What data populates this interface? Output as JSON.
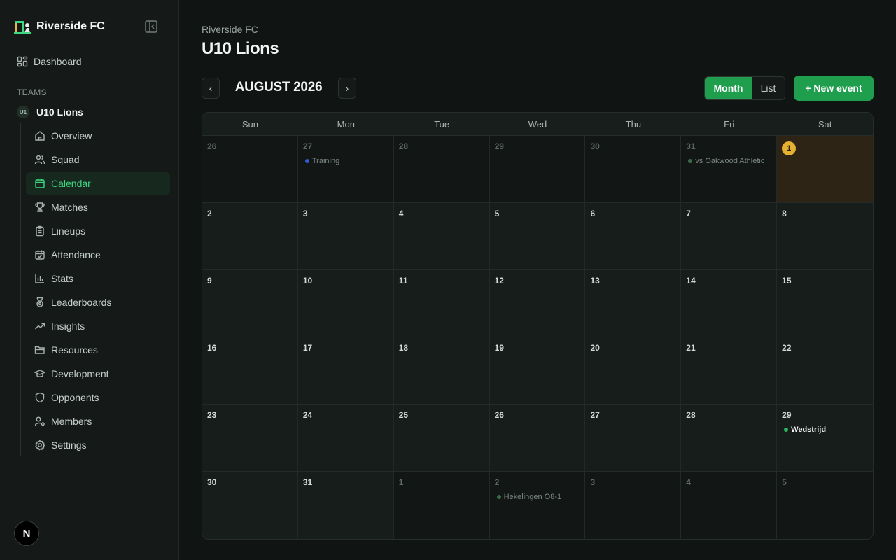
{
  "sidebar": {
    "brand": "Riverside FC",
    "dashboard": "Dashboard",
    "teams_label": "TEAMS",
    "team": {
      "badge": "U1",
      "name": "U10 Lions"
    },
    "items": [
      {
        "label": "Overview",
        "icon": "home-icon",
        "active": false
      },
      {
        "label": "Squad",
        "icon": "users-icon",
        "active": false
      },
      {
        "label": "Calendar",
        "icon": "calendar-icon",
        "active": true
      },
      {
        "label": "Matches",
        "icon": "trophy-icon",
        "active": false
      },
      {
        "label": "Lineups",
        "icon": "clipboard-icon",
        "active": false
      },
      {
        "label": "Attendance",
        "icon": "calendar-check-icon",
        "active": false
      },
      {
        "label": "Stats",
        "icon": "bar-chart-icon",
        "active": false
      },
      {
        "label": "Leaderboards",
        "icon": "medal-icon",
        "active": false
      },
      {
        "label": "Insights",
        "icon": "trending-up-icon",
        "active": false
      },
      {
        "label": "Resources",
        "icon": "folder-icon",
        "active": false
      },
      {
        "label": "Development",
        "icon": "graduation-cap-icon",
        "active": false
      },
      {
        "label": "Opponents",
        "icon": "shield-icon",
        "active": false
      },
      {
        "label": "Members",
        "icon": "user-cog-icon",
        "active": false
      },
      {
        "label": "Settings",
        "icon": "gear-icon",
        "active": false
      }
    ],
    "fab": "N"
  },
  "header": {
    "breadcrumb": "Riverside FC",
    "title": "U10 Lions"
  },
  "toolbar": {
    "prev": "‹",
    "next": "›",
    "month": "AUGUST 2026",
    "view_month": "Month",
    "view_list": "List",
    "new_event": "+ New event"
  },
  "calendar": {
    "weekdays": [
      "Sun",
      "Mon",
      "Tue",
      "Wed",
      "Thu",
      "Fri",
      "Sat"
    ],
    "weeks": [
      [
        {
          "day": "26",
          "outside": true
        },
        {
          "day": "27",
          "outside": true,
          "event": {
            "label": "Training",
            "color": "#2f5fd0",
            "style": "dim"
          }
        },
        {
          "day": "28",
          "outside": true
        },
        {
          "day": "29",
          "outside": true
        },
        {
          "day": "30",
          "outside": true
        },
        {
          "day": "31",
          "outside": true,
          "event": {
            "label": "vs Oakwood Athletic",
            "color": "#3a6a4c",
            "style": "dim"
          }
        },
        {
          "day": "1",
          "today": true
        }
      ],
      [
        {
          "day": "2"
        },
        {
          "day": "3"
        },
        {
          "day": "4"
        },
        {
          "day": "5"
        },
        {
          "day": "6"
        },
        {
          "day": "7"
        },
        {
          "day": "8"
        }
      ],
      [
        {
          "day": "9"
        },
        {
          "day": "10"
        },
        {
          "day": "11"
        },
        {
          "day": "12"
        },
        {
          "day": "13"
        },
        {
          "day": "14"
        },
        {
          "day": "15"
        }
      ],
      [
        {
          "day": "16"
        },
        {
          "day": "17"
        },
        {
          "day": "18"
        },
        {
          "day": "19"
        },
        {
          "day": "20"
        },
        {
          "day": "21"
        },
        {
          "day": "22"
        }
      ],
      [
        {
          "day": "23"
        },
        {
          "day": "24"
        },
        {
          "day": "25"
        },
        {
          "day": "26"
        },
        {
          "day": "27"
        },
        {
          "day": "28"
        },
        {
          "day": "29",
          "event": {
            "label": "Wedstrijd",
            "color": "#28b860",
            "style": "bright"
          }
        }
      ],
      [
        {
          "day": "30"
        },
        {
          "day": "31"
        },
        {
          "day": "1",
          "outside": true
        },
        {
          "day": "2",
          "outside": true,
          "event": {
            "label": "Hekelingen O8-1",
            "color": "#3a6a4c",
            "style": "dim"
          }
        },
        {
          "day": "3",
          "outside": true
        },
        {
          "day": "4",
          "outside": true
        },
        {
          "day": "5",
          "outside": true
        }
      ]
    ]
  }
}
